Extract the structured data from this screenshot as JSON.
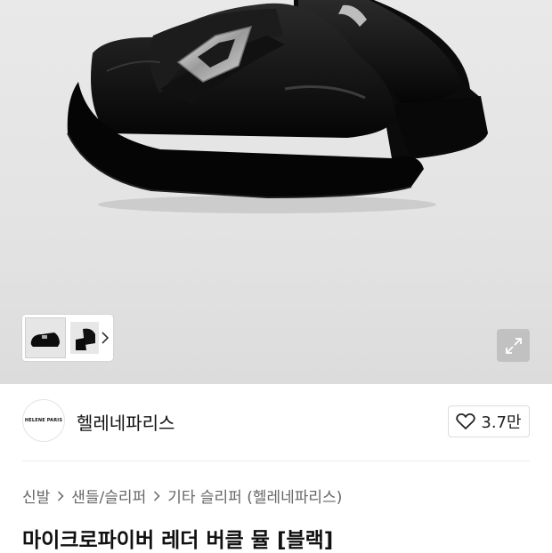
{
  "gallery": {
    "image_alt_icon": "black-leather-buckle-mule-shoes",
    "thumbnail_next_icon": "chevron-right-icon",
    "expand_icon": "expand-arrows-icon"
  },
  "brand": {
    "logo_text": "HELENE PARIS",
    "name": "헬레네파리스",
    "like_icon": "heart-outline-icon",
    "like_count": "3.7만"
  },
  "breadcrumb": {
    "items": [
      "신발",
      "샌들/슬리퍼",
      "기타 슬리퍼 (헬레네파리스)"
    ],
    "separator_icon": "chevron-right-icon"
  },
  "product": {
    "title": "마이크로파이버 레더 버클 뮬 [블랙]"
  },
  "colors": {
    "hero_bg": "#e6e6e6",
    "text_primary": "#111111",
    "text_secondary": "#666666",
    "border": "#dcdcdc"
  }
}
